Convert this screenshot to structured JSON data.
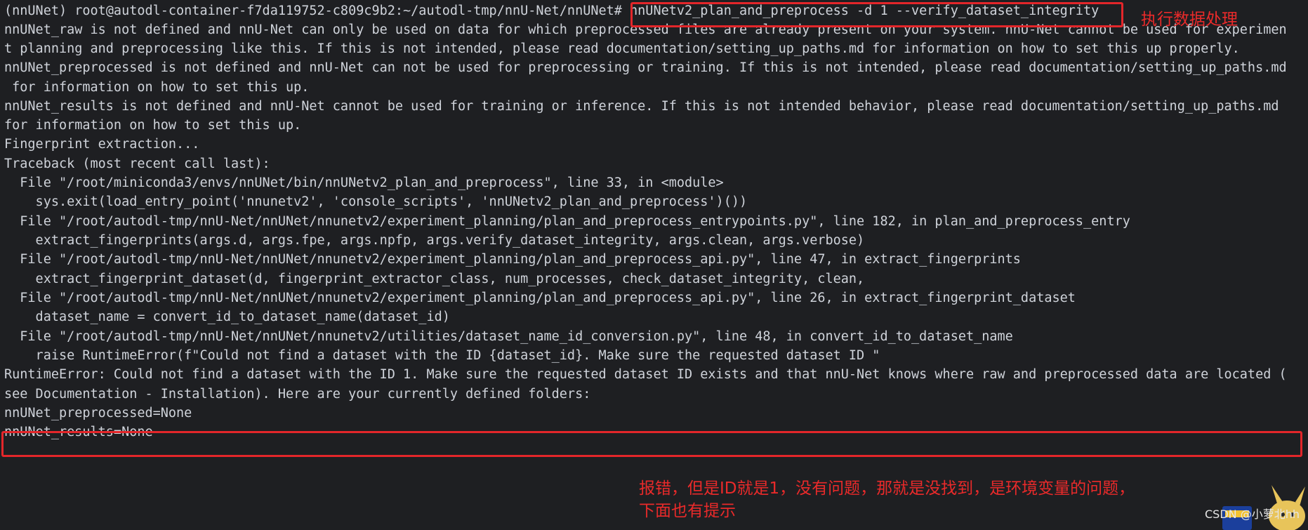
{
  "terminal": {
    "lines": [
      "(nnUNet) root@autodl-container-f7da119752-c809c9b2:~/autodl-tmp/nnU-Net/nnUNet# nnUNetv2_plan_and_preprocess -d 1 --verify_dataset_integrity",
      "nnUNet_raw is not defined and nnU-Net can only be used on data for which preprocessed files are already present on your system. nnU-Net cannot be used for experimen",
      "t planning and preprocessing like this. If this is not intended, please read documentation/setting_up_paths.md for information on how to set this up properly.",
      "nnUNet_preprocessed is not defined and nnU-Net can not be used for preprocessing or training. If this is not intended, please read documentation/setting_up_paths.md",
      " for information on how to set this up.",
      "nnUNet_results is not defined and nnU-Net cannot be used for training or inference. If this is not intended behavior, please read documentation/setting_up_paths.md",
      "for information on how to set this up.",
      "Fingerprint extraction...",
      "Traceback (most recent call last):",
      "  File \"/root/miniconda3/envs/nnUNet/bin/nnUNetv2_plan_and_preprocess\", line 33, in <module>",
      "    sys.exit(load_entry_point('nnunetv2', 'console_scripts', 'nnUNetv2_plan_and_preprocess')())",
      "  File \"/root/autodl-tmp/nnU-Net/nnUNet/nnunetv2/experiment_planning/plan_and_preprocess_entrypoints.py\", line 182, in plan_and_preprocess_entry",
      "    extract_fingerprints(args.d, args.fpe, args.npfp, args.verify_dataset_integrity, args.clean, args.verbose)",
      "  File \"/root/autodl-tmp/nnU-Net/nnUNet/nnunetv2/experiment_planning/plan_and_preprocess_api.py\", line 47, in extract_fingerprints",
      "    extract_fingerprint_dataset(d, fingerprint_extractor_class, num_processes, check_dataset_integrity, clean,",
      "  File \"/root/autodl-tmp/nnU-Net/nnUNet/nnunetv2/experiment_planning/plan_and_preprocess_api.py\", line 26, in extract_fingerprint_dataset",
      "    dataset_name = convert_id_to_dataset_name(dataset_id)",
      "  File \"/root/autodl-tmp/nnU-Net/nnUNet/nnunetv2/utilities/dataset_name_id_conversion.py\", line 48, in convert_id_to_dataset_name",
      "    raise RuntimeError(f\"Could not find a dataset with the ID {dataset_id}. Make sure the requested dataset ID \"",
      "RuntimeError: Could not find a dataset with the ID 1. Make sure the requested dataset ID exists and that nnU-Net knows where raw and preprocessed data are located (",
      "see Documentation - Installation). Here are your currently defined folders:",
      "nnUNet_preprocessed=None",
      "nnUNet_results=None"
    ]
  },
  "annotations": {
    "command_note": "执行数据处理",
    "error_note_line1": "报错，但是ID就是1，没有问题，那就是没找到，是环境变量的问题，",
    "error_note_line2": "下面也有提示"
  },
  "watermark": "CSDN @小萝北hh",
  "colors": {
    "background": "#1e1f22",
    "text": "#cfd3da",
    "highlight": "#e3262a"
  }
}
